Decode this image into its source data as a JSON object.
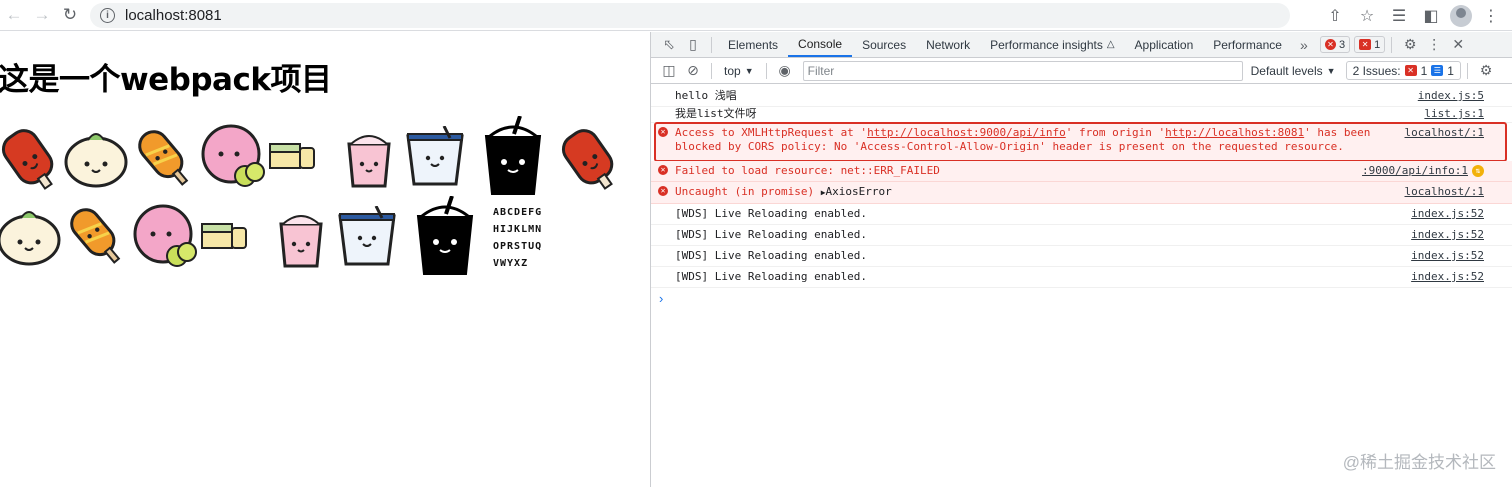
{
  "browser": {
    "url": "localhost:8081"
  },
  "page": {
    "title": "这是一个webpack项目",
    "font_sample": [
      "ABCDEFG",
      "HIJKLMN",
      "OPRSTUQ",
      "VWYXZ"
    ]
  },
  "devtools": {
    "tabs": [
      "Elements",
      "Console",
      "Sources",
      "Network",
      "Performance insights",
      "Application",
      "Performance"
    ],
    "active_tab": "Console",
    "error_count": "3",
    "warning_count": "1",
    "context": "top",
    "filter_placeholder": "Filter",
    "levels": "Default levels",
    "issues_label": "2 Issues:",
    "issues_errors": "1",
    "issues_info": "1"
  },
  "console": {
    "rows": [
      {
        "type": "log",
        "text": "hello 浅唱",
        "source": "index.js:5"
      },
      {
        "type": "log",
        "text": "我是list文件呀",
        "source": "list.js:1"
      },
      {
        "type": "error",
        "pre": "Access to XMLHttpRequest at '",
        "link1": "http://localhost:9000/api/info",
        "mid": "' from origin '",
        "link2": "http://localhost:8081",
        "post": "' has been",
        "line2": "blocked by CORS policy: No 'Access-Control-Allow-Origin' header is present on the requested resource.",
        "source": "localhost/:1"
      },
      {
        "type": "error",
        "text": "Failed to load resource: net::ERR_FAILED",
        "source": ":9000/api/info:1"
      },
      {
        "type": "error",
        "pre": "Uncaught (in promise) ",
        "obj": "AxiosError",
        "source": "localhost/:1"
      },
      {
        "type": "log",
        "text": "[WDS] Live Reloading enabled.",
        "source": "index.js:52"
      },
      {
        "type": "log",
        "text": "[WDS] Live Reloading enabled.",
        "source": "index.js:52"
      },
      {
        "type": "log",
        "text": "[WDS] Live Reloading enabled.",
        "source": "index.js:52"
      },
      {
        "type": "log",
        "text": "[WDS] Live Reloading enabled.",
        "source": "index.js:52"
      }
    ]
  },
  "watermark": "@稀土掘金技术社区"
}
